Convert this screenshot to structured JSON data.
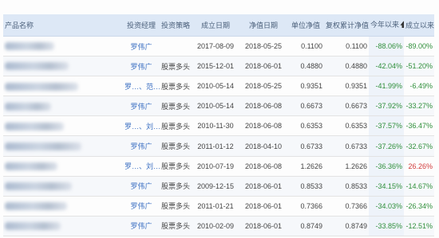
{
  "columns": {
    "name": "产品名称",
    "manager": "投资经理",
    "strategy": "投资策略",
    "established": "成立日期",
    "nav_date": "净值日期",
    "unit_nav": "单位净值",
    "cum_nav": "复权累计净值",
    "ytd": "今年以来",
    "ytd_sort_icon": "arrow-up-icon",
    "since_inception": "成立以来"
  },
  "colors": {
    "header_bg": "#dde8f6",
    "link": "#3b6fc2",
    "negative": "#2f8f3a",
    "positive": "#d23a3a"
  },
  "rows": [
    {
      "manager": "罗伟广",
      "strategy": "",
      "established": "2017-08-09",
      "nav_date": "2018-05-25",
      "unit_nav": "0.1100",
      "cum_nav": "0.1100",
      "ytd": "-88.06%",
      "since": "-89.00%",
      "since_sign": "neg"
    },
    {
      "manager": "罗伟广",
      "strategy": "股票多头",
      "established": "2015-12-01",
      "nav_date": "2018-06-01",
      "unit_nav": "0.4880",
      "cum_nav": "0.4880",
      "ytd": "-42.04%",
      "since": "-51.20%",
      "since_sign": "neg"
    },
    {
      "manager": "罗…、范…",
      "strategy": "股票多头",
      "established": "2010-05-14",
      "nav_date": "2018-05-25",
      "unit_nav": "0.9351",
      "cum_nav": "0.9351",
      "ytd": "-41.99%",
      "since": "-6.49%",
      "since_sign": "neg"
    },
    {
      "manager": "罗伟广",
      "strategy": "股票多头",
      "established": "2010-05-14",
      "nav_date": "2018-06-08",
      "unit_nav": "0.6673",
      "cum_nav": "0.6673",
      "ytd": "-37.92%",
      "since": "-33.27%",
      "since_sign": "neg"
    },
    {
      "manager": "罗…、刘…",
      "strategy": "股票多头",
      "established": "2010-11-30",
      "nav_date": "2018-06-08",
      "unit_nav": "0.6353",
      "cum_nav": "0.6353",
      "ytd": "-37.57%",
      "since": "-36.47%",
      "since_sign": "neg"
    },
    {
      "manager": "罗伟广",
      "strategy": "股票多头",
      "established": "2011-01-12",
      "nav_date": "2018-04-10",
      "unit_nav": "0.6733",
      "cum_nav": "0.6733",
      "ytd": "-37.26%",
      "since": "-32.67%",
      "since_sign": "neg"
    },
    {
      "manager": "罗…、刘…",
      "strategy": "股票多头",
      "established": "2010-07-19",
      "nav_date": "2018-06-08",
      "unit_nav": "1.2626",
      "cum_nav": "1.2626",
      "ytd": "-36.36%",
      "since": "26.26%",
      "since_sign": "pos"
    },
    {
      "manager": "罗伟广",
      "strategy": "股票多头",
      "established": "2009-12-15",
      "nav_date": "2018-06-01",
      "unit_nav": "0.8533",
      "cum_nav": "0.8533",
      "ytd": "-34.15%",
      "since": "-14.67%",
      "since_sign": "neg"
    },
    {
      "manager": "罗伟广",
      "strategy": "股票多头",
      "established": "2011-01-21",
      "nav_date": "2018-06-01",
      "unit_nav": "0.7366",
      "cum_nav": "0.7366",
      "ytd": "-34.03%",
      "since": "-26.34%",
      "since_sign": "neg"
    },
    {
      "manager": "罗伟广",
      "strategy": "股票多头",
      "established": "2010-02-09",
      "nav_date": "2018-06-01",
      "unit_nav": "0.8749",
      "cum_nav": "0.8749",
      "ytd": "-33.85%",
      "since": "-12.51%",
      "since_sign": "neg"
    }
  ]
}
